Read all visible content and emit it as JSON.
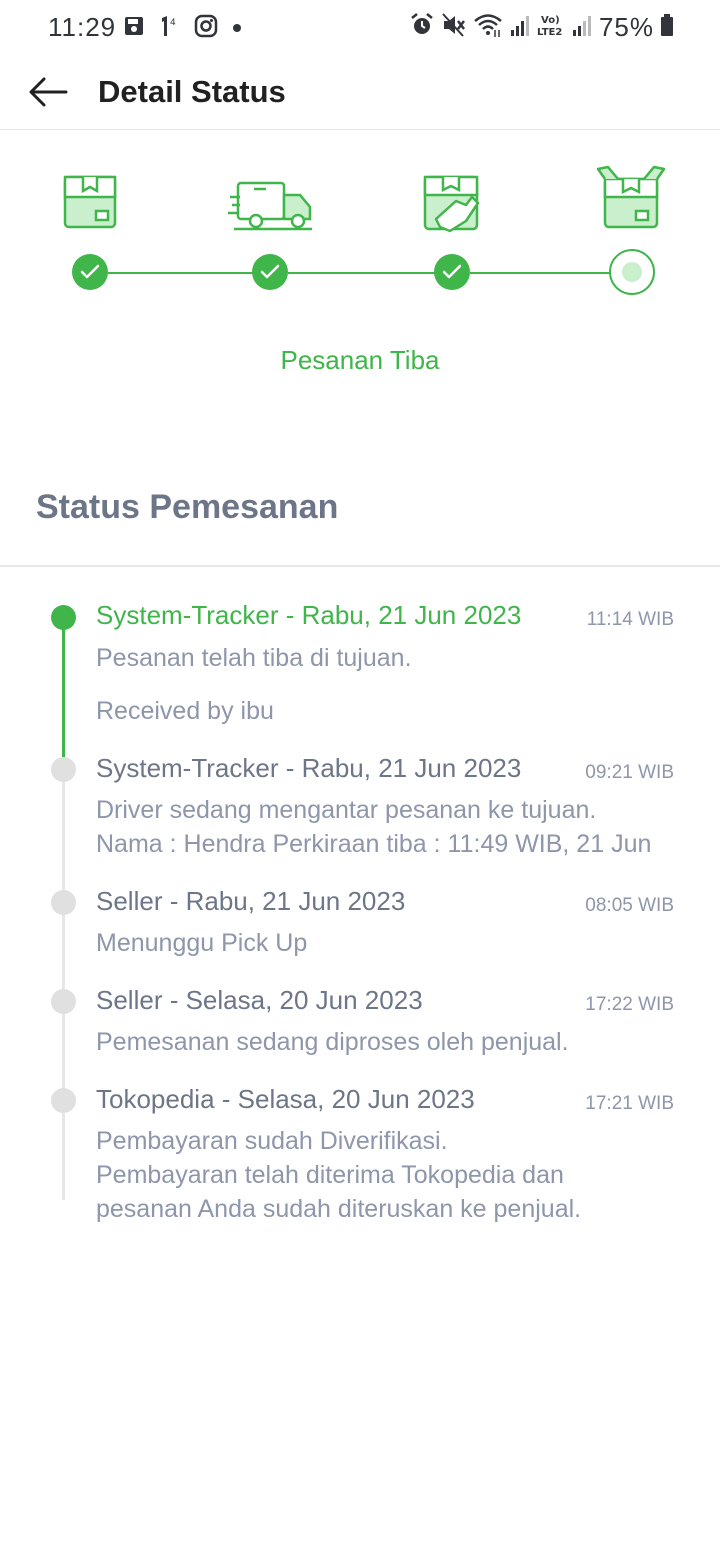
{
  "status_bar": {
    "time": "11:29",
    "battery": "75%"
  },
  "header": {
    "title": "Detail Status"
  },
  "stepper": {
    "accent": "#3FB54A",
    "steps": [
      {
        "icon": "package-icon",
        "state": "done"
      },
      {
        "icon": "delivery-truck-icon",
        "state": "done"
      },
      {
        "icon": "package-handover-icon",
        "state": "done"
      },
      {
        "icon": "open-package-icon",
        "state": "current"
      }
    ],
    "current_label": "Pesanan Tiba"
  },
  "order_status": {
    "title": "Status Pemesanan",
    "entries": [
      {
        "title": "System-Tracker - Rabu, 21 Jun 2023",
        "time": "11:14 WIB",
        "description": "Pesanan telah tiba di tujuan.",
        "note": "Received by ibu",
        "active": true
      },
      {
        "title": "System-Tracker - Rabu, 21 Jun 2023",
        "time": "09:21 WIB",
        "description": "Driver sedang mengantar pesanan ke tujuan.\nNama : Hendra Perkiraan tiba : 11:49 WIB, 21 Jun",
        "active": false
      },
      {
        "title": "Seller - Rabu, 21 Jun 2023",
        "time": "08:05 WIB",
        "description": "Menunggu Pick Up",
        "active": false
      },
      {
        "title": "Seller - Selasa, 20 Jun 2023",
        "time": "17:22 WIB",
        "description": "Pemesanan sedang diproses oleh penjual.",
        "active": false
      },
      {
        "title": "Tokopedia - Selasa, 20 Jun 2023",
        "time": "17:21 WIB",
        "description": "Pembayaran sudah Diverifikasi.\nPembayaran telah diterima Tokopedia dan\npesanan Anda sudah diteruskan ke penjual.",
        "active": false
      }
    ]
  }
}
